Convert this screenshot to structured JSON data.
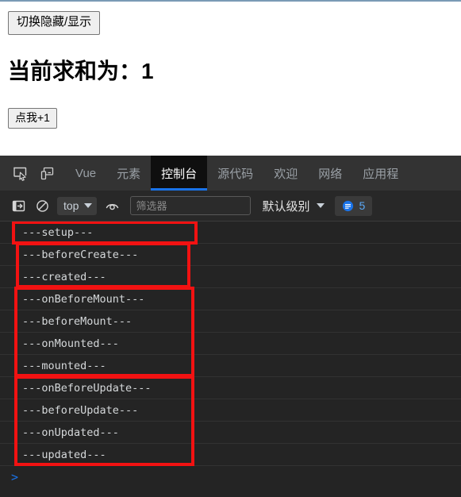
{
  "page": {
    "toggle_button_label": "切换隐藏/显示",
    "heading": "当前求和为：1",
    "increment_button_label": "点我+1"
  },
  "devtools": {
    "icons": {
      "inspect": "inspect-cursor-icon",
      "device": "device-toolbar-icon",
      "console_sidebar": "console-sidebar-icon",
      "clear": "clear-console-icon",
      "eye": "live-expression-icon",
      "issues": "issues-message-icon"
    },
    "tabs": [
      {
        "label": "Vue",
        "active": false
      },
      {
        "label": "元素",
        "active": false
      },
      {
        "label": "控制台",
        "active": true
      },
      {
        "label": "源代码",
        "active": false
      },
      {
        "label": "欢迎",
        "active": false
      },
      {
        "label": "网络",
        "active": false
      },
      {
        "label": "应用程",
        "active": false
      }
    ],
    "toolbar": {
      "context_value": "top",
      "filter_placeholder": "筛选器",
      "filter_value": "",
      "level_label": "默认级别",
      "issues_count": "5"
    },
    "console": {
      "prompt": ">",
      "logs": [
        "---setup---",
        "---beforeCreate---",
        "---created---",
        "---onBeforeMount---",
        "---beforeMount---",
        "---onMounted---",
        "---mounted---",
        "---onBeforeUpdate---",
        "---beforeUpdate---",
        "---onUpdated---",
        "---updated---"
      ]
    },
    "annotations": {
      "color": "#f21212",
      "groups": [
        {
          "name": "setup-group",
          "logs": [
            "---setup---"
          ]
        },
        {
          "name": "create-group",
          "logs": [
            "---beforeCreate---",
            "---created---"
          ]
        },
        {
          "name": "mount-group",
          "logs": [
            "---onBeforeMount---",
            "---beforeMount---",
            "---onMounted---",
            "---mounted---"
          ]
        },
        {
          "name": "update-group",
          "logs": [
            "---onBeforeUpdate---",
            "---beforeUpdate---",
            "---onUpdated---",
            "---updated---"
          ]
        }
      ]
    }
  }
}
